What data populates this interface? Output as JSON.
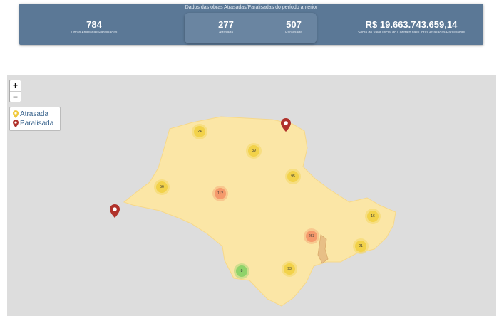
{
  "summary": {
    "title": "Dados das obras Atrasadas/Paralisadas do período anterior",
    "total": {
      "value": "784",
      "label": "Obras Atrasadas/Paralisadas"
    },
    "atrasada": {
      "value": "277",
      "label": "Atrasada"
    },
    "paralisada": {
      "value": "507",
      "label": "Paralisada"
    },
    "valor": {
      "value": "R$ 19.663.743.659,14",
      "label": "Soma do Valor Inicial do Contrato das Obras Atrasadas/Paralisadas"
    }
  },
  "map": {
    "zoom_in": "+",
    "zoom_out": "−",
    "legend": [
      {
        "label": "Atrasada",
        "color": "#f0c93a",
        "icon": "pin-yellow-icon"
      },
      {
        "label": "Paralisada",
        "color": "#b0322b",
        "icon": "pin-red-icon"
      }
    ],
    "clusters": [
      {
        "count": "24",
        "color": "#f2d24a"
      },
      {
        "count": "39",
        "color": "#f2d24a"
      },
      {
        "count": "95",
        "color": "#f2d24a"
      },
      {
        "count": "56",
        "color": "#f2d24a"
      },
      {
        "count": "112",
        "color": "#f59a6c"
      },
      {
        "count": "16",
        "color": "#f2d24a"
      },
      {
        "count": "263",
        "color": "#f59a6c"
      },
      {
        "count": "21",
        "color": "#f2d24a"
      },
      {
        "count": "93",
        "color": "#f2d24a"
      },
      {
        "count": "8",
        "color": "#8fd36a"
      }
    ]
  }
}
